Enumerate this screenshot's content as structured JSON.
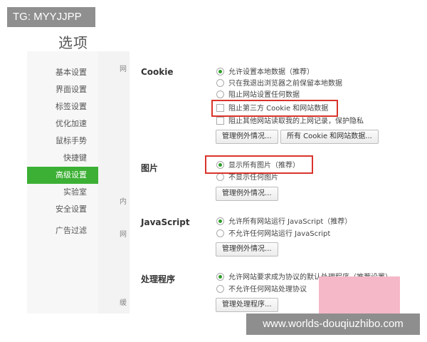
{
  "overlay": {
    "tg": "TG: MYYJJPP",
    "watermark": "www.worlds-douqiuzhibo.com"
  },
  "page": {
    "title": "选项"
  },
  "sidebar": {
    "items": [
      {
        "label": "基本设置"
      },
      {
        "label": "界面设置"
      },
      {
        "label": "标签设置"
      },
      {
        "label": "优化加速"
      },
      {
        "label": "鼠标手势"
      },
      {
        "label": "快捷键"
      },
      {
        "label": "高级设置",
        "active": true
      },
      {
        "label": "实验室"
      },
      {
        "label": "安全设置"
      },
      {
        "label": "广告过滤"
      }
    ]
  },
  "peek": {
    "c1": "网",
    "c2": "内",
    "c3": "网",
    "c4": "缓"
  },
  "cookie": {
    "label": "Cookie",
    "opt1": "允许设置本地数据（推荐）",
    "opt2": "只在我退出浏览器之前保留本地数据",
    "opt3": "阻止网站设置任何数据",
    "chk1": "阻止第三方 Cookie 和网站数据",
    "chk2": "阻止其他网站读取我的上网记录，保护隐私",
    "btn_exceptions": "管理例外情况...",
    "btn_all": "所有 Cookie 和网站数据..."
  },
  "images": {
    "label": "图片",
    "opt1": "显示所有图片（推荐）",
    "opt2": "不显示任何图片",
    "btn_exceptions": "管理例外情况..."
  },
  "javascript": {
    "label": "JavaScript",
    "opt1": "允许所有网站运行 JavaScript（推荐）",
    "opt2": "不允许任何网站运行 JavaScript",
    "btn_exceptions": "管理例外情况..."
  },
  "handlers": {
    "label": "处理程序",
    "opt1": "允许网站要求成为协议的默认处理程序（推荐设置）",
    "opt2": "不允许任何网站处理协议",
    "btn_manage": "管理处理程序..."
  },
  "colors": {
    "accent": "#3cb034",
    "highlight": "#d9342b",
    "pink": "#f5b8c9"
  }
}
